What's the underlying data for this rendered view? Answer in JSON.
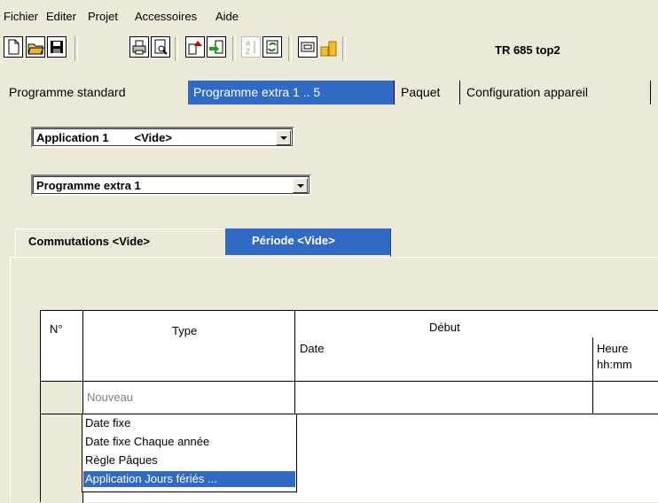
{
  "menu": [
    "Fichier",
    "Editer",
    "Projet",
    "Accessoires",
    "Aide"
  ],
  "toolbar": {
    "device_label": "TR 685 top2",
    "icons": [
      "new-file-icon",
      "open-folder-icon",
      "save-icon",
      "print-icon",
      "print-preview-icon",
      "upload-icon",
      "download-icon",
      "sort-az-icon",
      "refresh-icon",
      "display-icon",
      "coins-icon"
    ]
  },
  "tabs": [
    "Programme standard",
    "Programme extra 1 .. 5",
    "Paquet",
    "Configuration appareil"
  ],
  "application_select": {
    "value": "Application 1        <Vide>"
  },
  "program_select": {
    "value": "Programme extra 1"
  },
  "subtabs": [
    "Commutations  <Vide>",
    "Période  <Vide>"
  ],
  "grid": {
    "headers": {
      "no": "N°",
      "type": "Type",
      "debut": "Début",
      "date": "Date",
      "heure": "Heure",
      "heure_format": "hh:mm"
    },
    "new_row_label": "Nouveau"
  },
  "dropdown_options": [
    "Date fixe",
    "Date fixe Chaque année",
    "Règle Pâques",
    "Application Jours fériés ..."
  ],
  "colors": {
    "accent": "#316ac5",
    "background": "#ece9d8"
  }
}
